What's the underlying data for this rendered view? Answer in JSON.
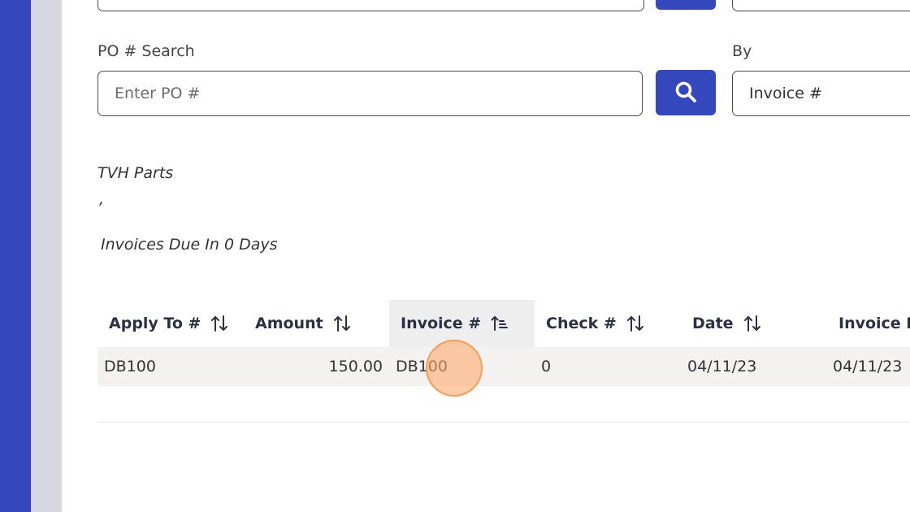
{
  "form": {
    "po_label": "PO # Search",
    "po_placeholder": "Enter PO #",
    "po_value": "",
    "by_label": "By",
    "by_selected": "Invoice #"
  },
  "vendor": {
    "name": "TVH Parts",
    "address": ",",
    "due_text": "Invoices Due In 0 Days"
  },
  "table": {
    "columns": [
      "Apply To #",
      "Amount",
      "Invoice #",
      "Check #",
      "Date",
      "Invoice Date"
    ],
    "rows": [
      [
        "DB100",
        "150.00",
        "DB100",
        "0",
        "04/11/23",
        "04/11/23"
      ]
    ]
  },
  "colors": {
    "accent": "#3447bd",
    "sidebar": "#d6d6e3",
    "row": "#f3f2f0",
    "header_active": "#eeeeee"
  },
  "icons": {
    "search": "search-icon",
    "sort": "sort-icon",
    "sort_asc": "sort-ascending-icon"
  }
}
